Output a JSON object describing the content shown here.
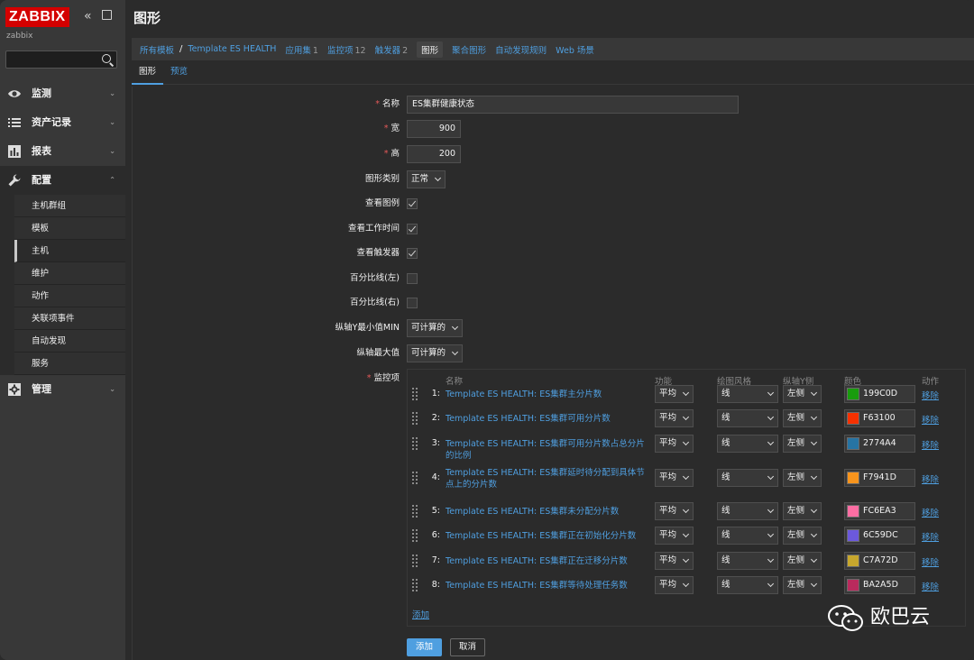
{
  "sidebar": {
    "logo": "ZABBIX",
    "server_name": "zabbix",
    "search_placeholder": "",
    "menu": [
      {
        "label": "监测"
      },
      {
        "label": "资产记录"
      },
      {
        "label": "报表"
      },
      {
        "label": "配置"
      },
      {
        "label": "管理"
      }
    ],
    "submenu": [
      "主机群组",
      "模板",
      "主机",
      "维护",
      "动作",
      "关联项事件",
      "自动发现",
      "服务"
    ],
    "submenu_selected": "主机"
  },
  "header": {
    "title": "图形"
  },
  "breadcrumbs": {
    "all_templates": "所有模板",
    "template": "Template ES HEALTH",
    "apps": "应用集",
    "apps_count": "1",
    "items": "监控项",
    "items_count": "12",
    "triggers": "触发器",
    "triggers_count": "2",
    "graphs": "图形",
    "screens": "聚合图形",
    "discovery": "自动发现规则",
    "web": "Web 场景"
  },
  "tabs": [
    "图形",
    "预览"
  ],
  "form": {
    "name_label": "名称",
    "name_value": "ES集群健康状态",
    "width_label": "宽",
    "width_value": "900",
    "height_label": "高",
    "height_value": "200",
    "type_label": "图形类别",
    "type_value": "正常",
    "legend_label": "查看图例",
    "worktime_label": "查看工作时间",
    "triggers_label": "查看触发器",
    "percent_left_label": "百分比线(左)",
    "percent_right_label": "百分比线(右)",
    "ymin_label": "纵轴Y最小值MIN",
    "ymin_value": "可计算的",
    "ymax_label": "纵轴最大值",
    "ymax_value": "可计算的",
    "items_label": "监控项"
  },
  "items_table": {
    "headers": {
      "name": "名称",
      "function": "功能",
      "draw_style": "绘图风格",
      "y_axis": "纵轴Y侧",
      "color": "颜色",
      "action": "动作"
    },
    "rows": [
      {
        "num": "1:",
        "name": "Template ES HEALTH: ES集群主分片数",
        "function": "平均",
        "style": "线",
        "axis": "左侧",
        "color": "199C0D",
        "color_hex": "#199C0D",
        "remove": "移除"
      },
      {
        "num": "2:",
        "name": "Template ES HEALTH: ES集群可用分片数",
        "function": "平均",
        "style": "线",
        "axis": "左侧",
        "color": "F63100",
        "color_hex": "#F63100",
        "remove": "移除"
      },
      {
        "num": "3:",
        "name": "Template ES HEALTH: ES集群可用分片数占总分片的比例",
        "function": "平均",
        "style": "线",
        "axis": "左侧",
        "color": "2774A4",
        "color_hex": "#2774A4",
        "remove": "移除"
      },
      {
        "num": "4:",
        "name": "Template ES HEALTH: ES集群延时待分配到具体节点上的分片数",
        "function": "平均",
        "style": "线",
        "axis": "左侧",
        "color": "F7941D",
        "color_hex": "#F7941D",
        "remove": "移除"
      },
      {
        "num": "5:",
        "name": "Template ES HEALTH: ES集群未分配分片数",
        "function": "平均",
        "style": "线",
        "axis": "左侧",
        "color": "FC6EA3",
        "color_hex": "#FC6EA3",
        "remove": "移除"
      },
      {
        "num": "6:",
        "name": "Template ES HEALTH: ES集群正在初始化分片数",
        "function": "平均",
        "style": "线",
        "axis": "左侧",
        "color": "6C59DC",
        "color_hex": "#6C59DC",
        "remove": "移除"
      },
      {
        "num": "7:",
        "name": "Template ES HEALTH: ES集群正在迁移分片数",
        "function": "平均",
        "style": "线",
        "axis": "左侧",
        "color": "C7A72D",
        "color_hex": "#C7A72D",
        "remove": "移除"
      },
      {
        "num": "8:",
        "name": "Template ES HEALTH: ES集群等待处理任务数",
        "function": "平均",
        "style": "线",
        "axis": "左侧",
        "color": "BA2A5D",
        "color_hex": "#BA2A5D",
        "remove": "移除"
      }
    ],
    "add_link": "添加"
  },
  "buttons": {
    "add": "添加",
    "cancel": "取消"
  },
  "watermark": {
    "text": "欧巴云"
  }
}
